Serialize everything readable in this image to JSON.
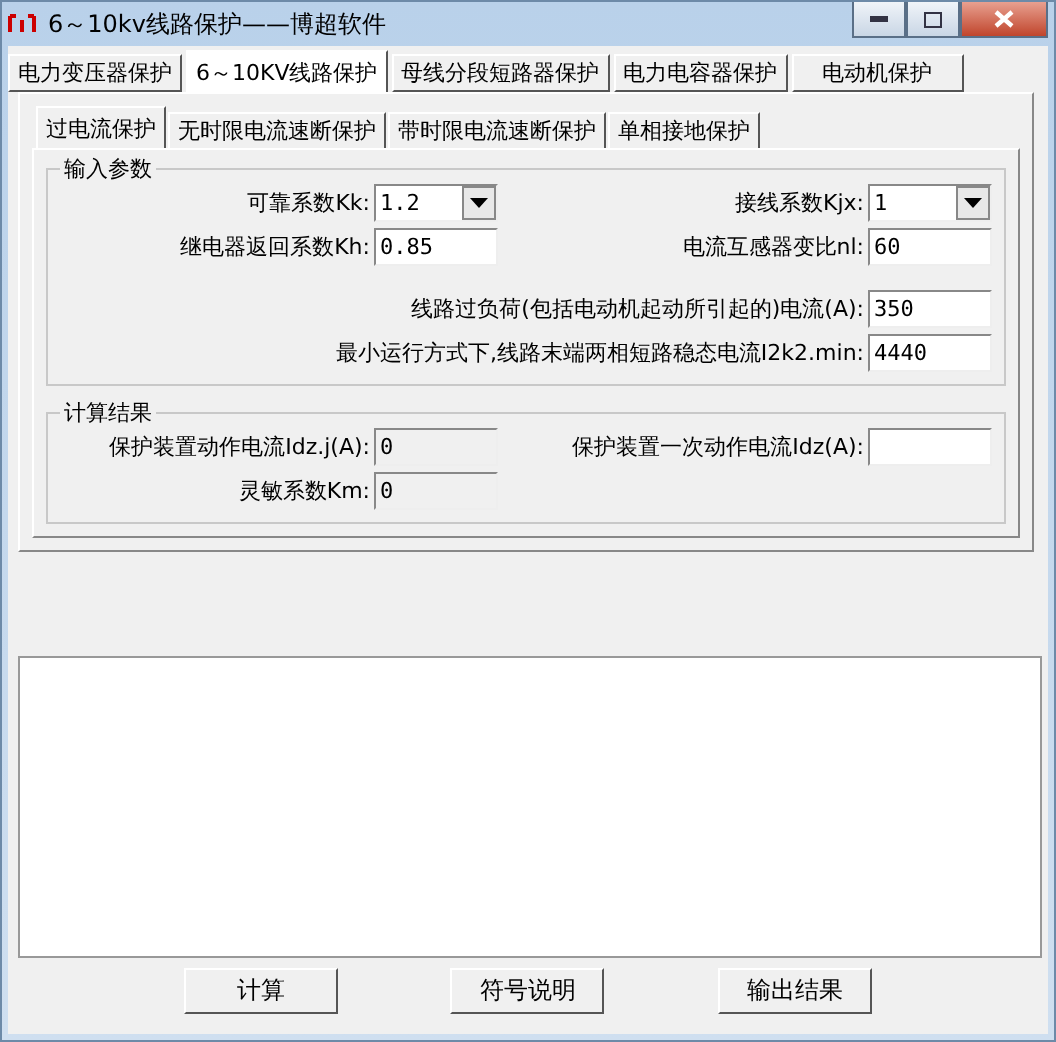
{
  "window": {
    "title": "6～10kv线路保护——博超软件"
  },
  "main_tabs": [
    {
      "label": "电力变压器保护",
      "selected": false
    },
    {
      "label": "6～10KV线路保护",
      "selected": true
    },
    {
      "label": "母线分段短路器保护",
      "selected": false
    },
    {
      "label": "电力电容器保护",
      "selected": false
    },
    {
      "label": "电动机保护",
      "selected": false
    }
  ],
  "sub_tabs": [
    {
      "label": "过电流保护",
      "selected": true
    },
    {
      "label": "无时限电流速断保护",
      "selected": false
    },
    {
      "label": "带时限电流速断保护",
      "selected": false
    },
    {
      "label": "单相接地保护",
      "selected": false
    }
  ],
  "input_group": {
    "title": "输入参数",
    "rows": [
      [
        {
          "label": "可靠系数Kk:",
          "value": "1.2",
          "kind": "combo"
        },
        {
          "label": "接线系数Kjx:",
          "value": "1",
          "kind": "combo"
        }
      ],
      [
        {
          "label": "继电器返回系数Kh:",
          "value": "0.85",
          "kind": "text"
        },
        {
          "label": "电流互感器变比nl:",
          "value": "60",
          "kind": "text"
        }
      ],
      [
        {
          "label": "线路过负荷(包括电动机起动所引起的)电流(A):",
          "value": "350",
          "kind": "text"
        }
      ],
      [
        {
          "label": "最小运行方式下,线路末端两相短路稳态电流I2k2.min:",
          "value": "4440",
          "kind": "text"
        }
      ]
    ]
  },
  "results_group": {
    "title": "计算结果",
    "rows": [
      [
        {
          "label": "保护装置动作电流Idz.j(A):",
          "value": "0",
          "kind": "readonly"
        },
        {
          "label": "保护装置一次动作电流Idz(A):",
          "kind": "text"
        }
      ],
      [
        {
          "label": "灵敏系数Km:",
          "value": "0",
          "kind": "readonly"
        }
      ]
    ]
  },
  "buttons": [
    "计算",
    "符号说明",
    "输出结果"
  ]
}
